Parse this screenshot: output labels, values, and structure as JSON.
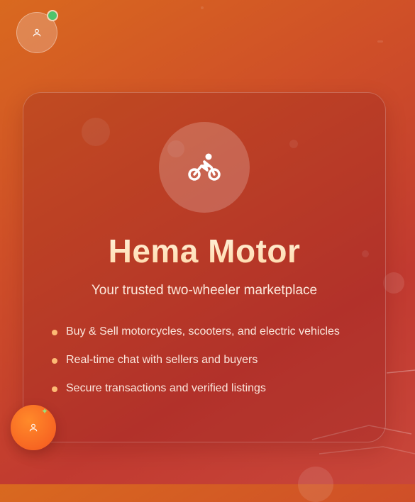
{
  "brand": {
    "title": "Hema Motor",
    "tagline": "Your trusted two-wheeler marketplace",
    "logo_icon": "motorcycle-rider-icon"
  },
  "features": [
    "Buy & Sell motorcycles, scooters, and electric vehicles",
    "Real-time chat with sellers and buyers",
    "Secure transactions and verified listings"
  ],
  "user_avatar": {
    "icon": "user-icon",
    "status": "online",
    "status_color": "#4ec46b"
  },
  "fab": {
    "icon": "user-icon",
    "badge_icon": "sparkle-icon",
    "color": "#f4561f"
  },
  "colors": {
    "accent": "#fdba74",
    "title_gradient_start": "#fff3dd",
    "title_gradient_end": "#ffd8a8"
  }
}
